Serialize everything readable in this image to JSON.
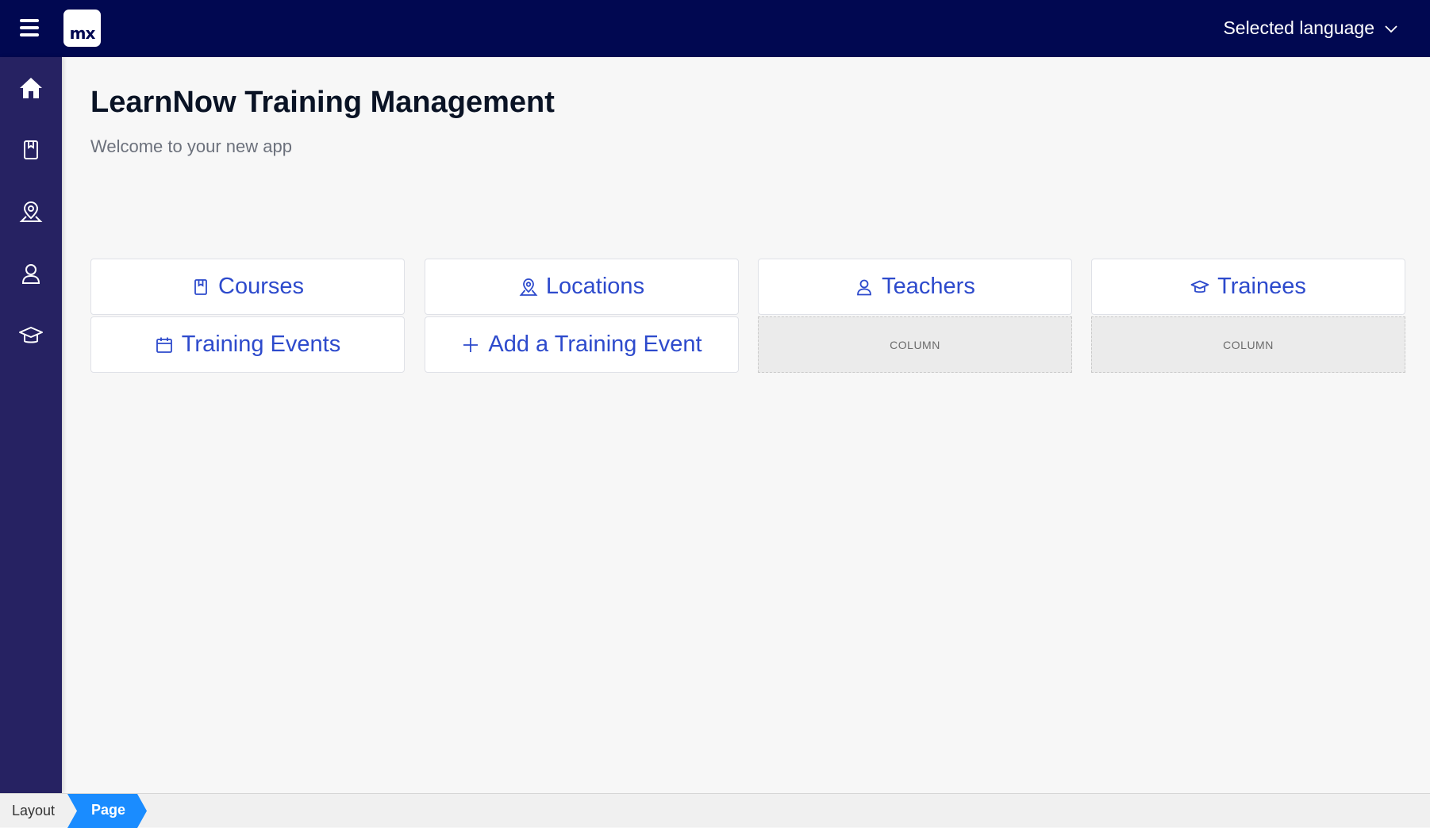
{
  "topbar": {
    "menu_icon": "hamburger-icon",
    "logo_text": "mx",
    "language_label": "Selected language",
    "language_icon": "chevron-down-icon"
  },
  "sidebar": {
    "items": [
      {
        "icon": "home-icon",
        "active": true
      },
      {
        "icon": "book-icon"
      },
      {
        "icon": "map-pin-icon"
      },
      {
        "icon": "user-icon"
      },
      {
        "icon": "graduation-cap-icon"
      }
    ]
  },
  "main": {
    "title": "LearnNow Training Management",
    "subtitle": "Welcome to your new app"
  },
  "cards": {
    "courses": {
      "label": "Courses",
      "icon": "book-icon"
    },
    "locations": {
      "label": "Locations",
      "icon": "map-pin-icon"
    },
    "teachers": {
      "label": "Teachers",
      "icon": "user-icon"
    },
    "trainees": {
      "label": "Trainees",
      "icon": "graduation-cap-icon"
    },
    "training_events": {
      "label": "Training Events",
      "icon": "calendar-icon"
    },
    "add_training_event": {
      "label": "Add a Training Event",
      "icon": "plus-icon"
    },
    "placeholder_1": "COLUMN",
    "placeholder_2": "COLUMN"
  },
  "statusbar": {
    "crumb_layout": "Layout",
    "crumb_page": "Page"
  },
  "colors": {
    "topbar_bg": "#010851",
    "sidebar_bg": "#262262",
    "link_blue": "#2d4acc",
    "crumb_active": "#1a8cff"
  }
}
